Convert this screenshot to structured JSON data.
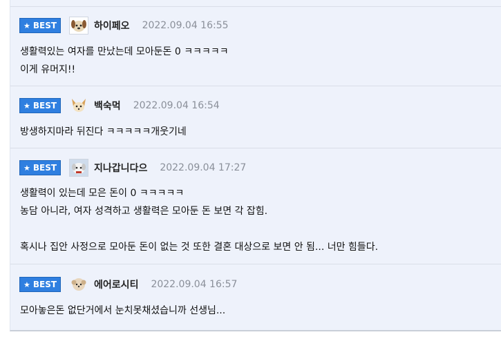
{
  "comments": [
    {
      "badge": "BEST",
      "avatar": "puppy-face-icon",
      "nickname": "하이페오",
      "time": "2022.09.04 16:55",
      "lines": [
        "생활력있는 여자를 만났는데 모아둔돈 0 ㅋㅋㅋㅋㅋ",
        "이게 유머지!!"
      ]
    },
    {
      "badge": "BEST",
      "avatar": "chihuahua-icon",
      "nickname": "백숙먹",
      "time": "2022.09.04 16:54",
      "lines": [
        "방생하지마라 뒤진다 ㅋㅋㅋㅋㅋ개웃기네"
      ]
    },
    {
      "badge": "BEST",
      "avatar": "fluffy-dog-icon",
      "nickname": "지나갑니다으",
      "time": "2022.09.04 17:27",
      "lines": [
        "생활력이 있는데 모은 돈이 0 ㅋㅋㅋㅋㅋ",
        "농담 아니라, 여자 성격하고 생활력은 모아둔 돈 보면 각 잡힘.",
        "",
        "혹시나 집안 사정으로 모아둔 돈이 없는 것 또한 결혼 대상으로 보면 안 됨... 너만 힘들다."
      ]
    },
    {
      "badge": "BEST",
      "avatar": "small-dog-icon",
      "nickname": "에어로시티",
      "time": "2022.09.04 16:57",
      "lines": [
        "모아놓은돈 없단거에서 눈치못채셨습니까 선생님..."
      ]
    }
  ]
}
